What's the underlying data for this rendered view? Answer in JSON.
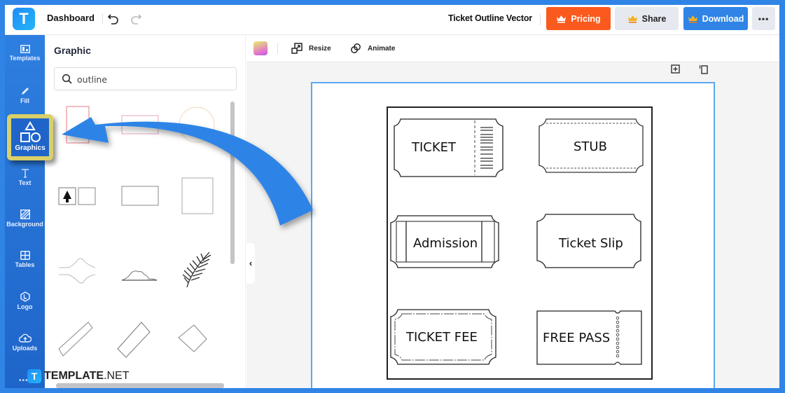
{
  "header": {
    "logo_letter": "T",
    "dashboard_label": "Dashboard",
    "document_title": "Ticket Outline Vector",
    "buttons": {
      "pricing": "Pricing",
      "share": "Share",
      "download": "Download",
      "more": "•••"
    },
    "colors": {
      "pricing": "#fb5a1e",
      "download": "#2f84e6",
      "share": "#e6e9f0"
    }
  },
  "sidebar": {
    "items": [
      {
        "label": "Templates",
        "icon": "templates-icon"
      },
      {
        "label": "Fill",
        "icon": "pencil-icon"
      },
      {
        "label": "Graphics",
        "icon": "shapes-icon",
        "active": true
      },
      {
        "label": "Text",
        "icon": "text-icon"
      },
      {
        "label": "Background",
        "icon": "background-icon"
      },
      {
        "label": "Tables",
        "icon": "table-icon"
      },
      {
        "label": "Logo",
        "icon": "logo-icon"
      },
      {
        "label": "Uploads",
        "icon": "cloud-upload-icon"
      }
    ],
    "more": "•••"
  },
  "panel": {
    "title": "Graphic",
    "search": {
      "value": "outline",
      "placeholder": "Search"
    },
    "results": [
      "red-rectangle-outline",
      "pink-rectangle-outline",
      "circle-outline",
      "tree-frame-outline",
      "rectangle-outline",
      "square-outline",
      "wavy-divider-outline",
      "cloud-outline",
      "palm-leaf-outline",
      "tilted-bar-outline",
      "tilted-rectangle-outline",
      "diamond-outline"
    ]
  },
  "toolbar": {
    "resize_label": "Resize",
    "animate_label": "Animate"
  },
  "canvas": {
    "tickets": [
      {
        "label": "TICKET",
        "style": "barcode-stub"
      },
      {
        "label": "STUB",
        "style": "dashed-border"
      },
      {
        "label": "Admission",
        "style": "side-panels"
      },
      {
        "label": "Ticket Slip",
        "style": "plain"
      },
      {
        "label": "TICKET FEE",
        "style": "double-border"
      },
      {
        "label": "FREE PASS",
        "style": "perforated-stub"
      }
    ]
  },
  "watermark": {
    "brand_bold": "TEMPLATE",
    "brand_light": ".NET"
  }
}
